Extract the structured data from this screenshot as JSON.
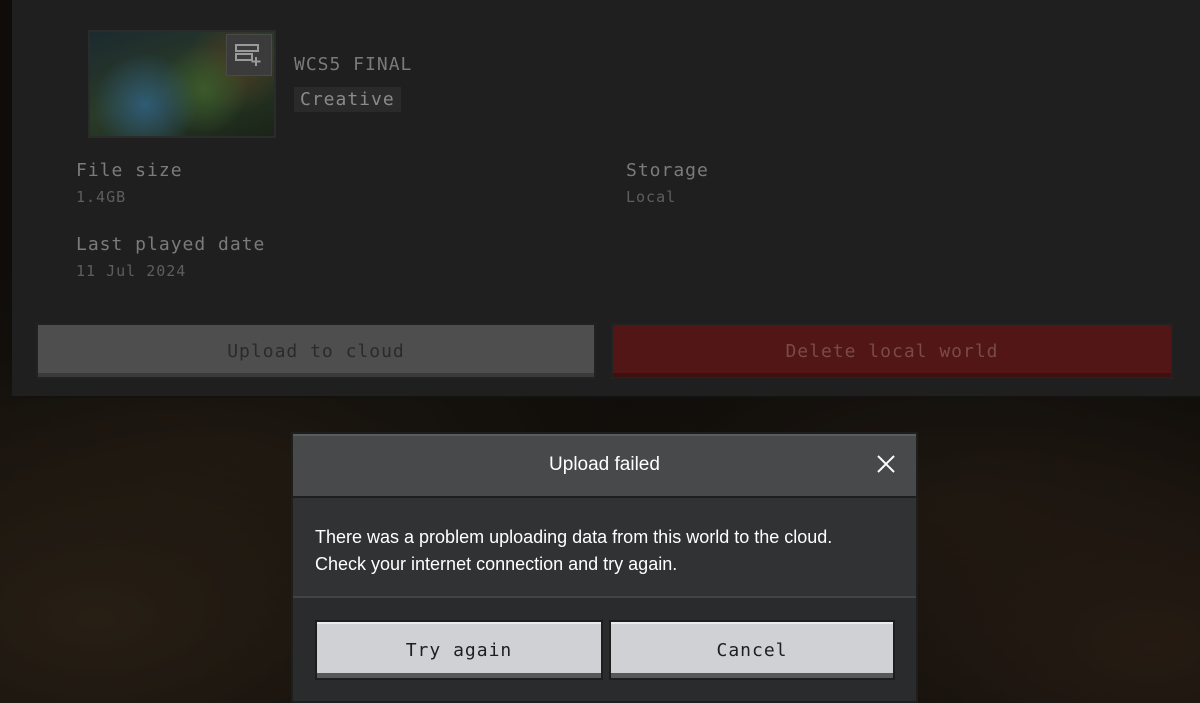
{
  "world": {
    "name": "WCS5 FINAL",
    "mode": "Creative",
    "file_size_label": "File size",
    "file_size_value": "1.4GB",
    "storage_label": "Storage",
    "storage_value": "Local",
    "last_played_label": "Last played date",
    "last_played_value": "11 Jul 2024",
    "thumbnail_icon": "server-add-icon"
  },
  "actions": {
    "upload_label": "Upload to cloud",
    "delete_label": "Delete local world"
  },
  "dialog": {
    "title": "Upload failed",
    "message": "There was a problem uploading data from this world to the cloud. Check your internet connection and try again.",
    "try_again_label": "Try again",
    "cancel_label": "Cancel",
    "close_icon": "close-icon"
  },
  "colors": {
    "delete_red": "#521616",
    "dialog_bg": "#313233",
    "button_light": "#d0d1d4"
  }
}
